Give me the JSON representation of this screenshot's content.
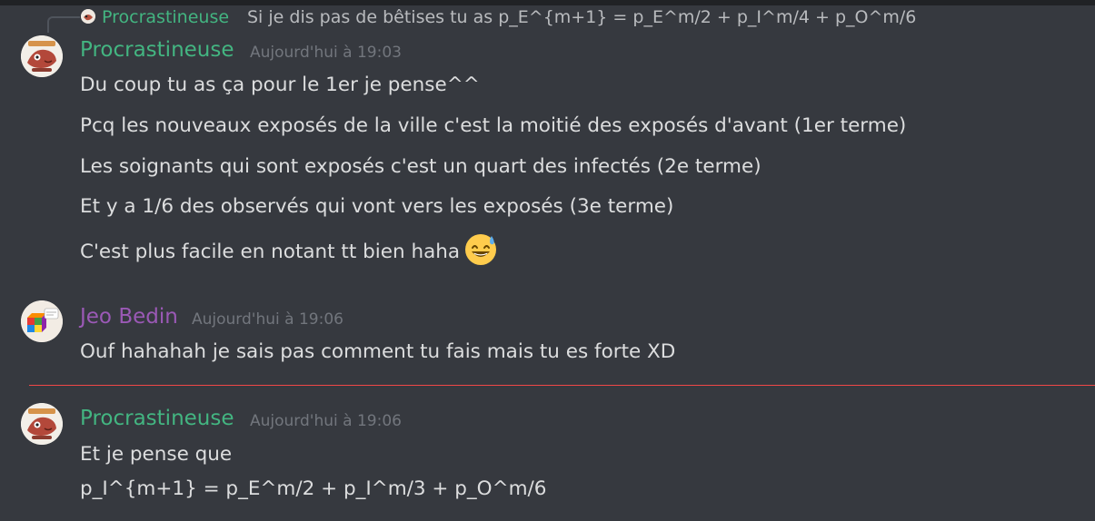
{
  "reply": {
    "author": "Procrastineuse",
    "text": "Si je dis pas de bêtises tu as p_E^{m+1} = p_E^m/2 + p_I^m/4 + p_O^m/6"
  },
  "messages": [
    {
      "author": "Procrastineuse",
      "timestamp": "Aujourd'hui à 19:03",
      "lines": [
        "Du coup tu as ça pour le 1er je pense^^",
        "Pcq les nouveaux exposés de la ville c'est la moitié des exposés d'avant (1er terme)",
        "Les soignants qui sont exposés c'est un quart des infectés (2e terme)",
        "Et y a 1/6 des observés qui vont vers les exposés (3e terme)",
        "C'est plus facile en notant tt bien haha"
      ],
      "emoji": "sweat-smile-emoji"
    },
    {
      "author": "Jeo Bedin",
      "timestamp": "Aujourd'hui à 19:06",
      "lines": [
        "Ouf hahahah je sais pas comment tu fais mais tu es forte XD"
      ]
    },
    {
      "author": "Procrastineuse",
      "timestamp": "Aujourd'hui à 19:06",
      "lines": [
        "Et je pense que",
        "p_I^{m+1} = p_E^m/2 + p_I^m/3 + p_O^m/6"
      ]
    }
  ],
  "colors": {
    "background": "#36393f",
    "procrastineuse": "#43b581",
    "jeo_bedin": "#9b59b6",
    "new_messages_divider": "#f04747",
    "timestamp": "#72767d",
    "text": "#dcddde"
  }
}
